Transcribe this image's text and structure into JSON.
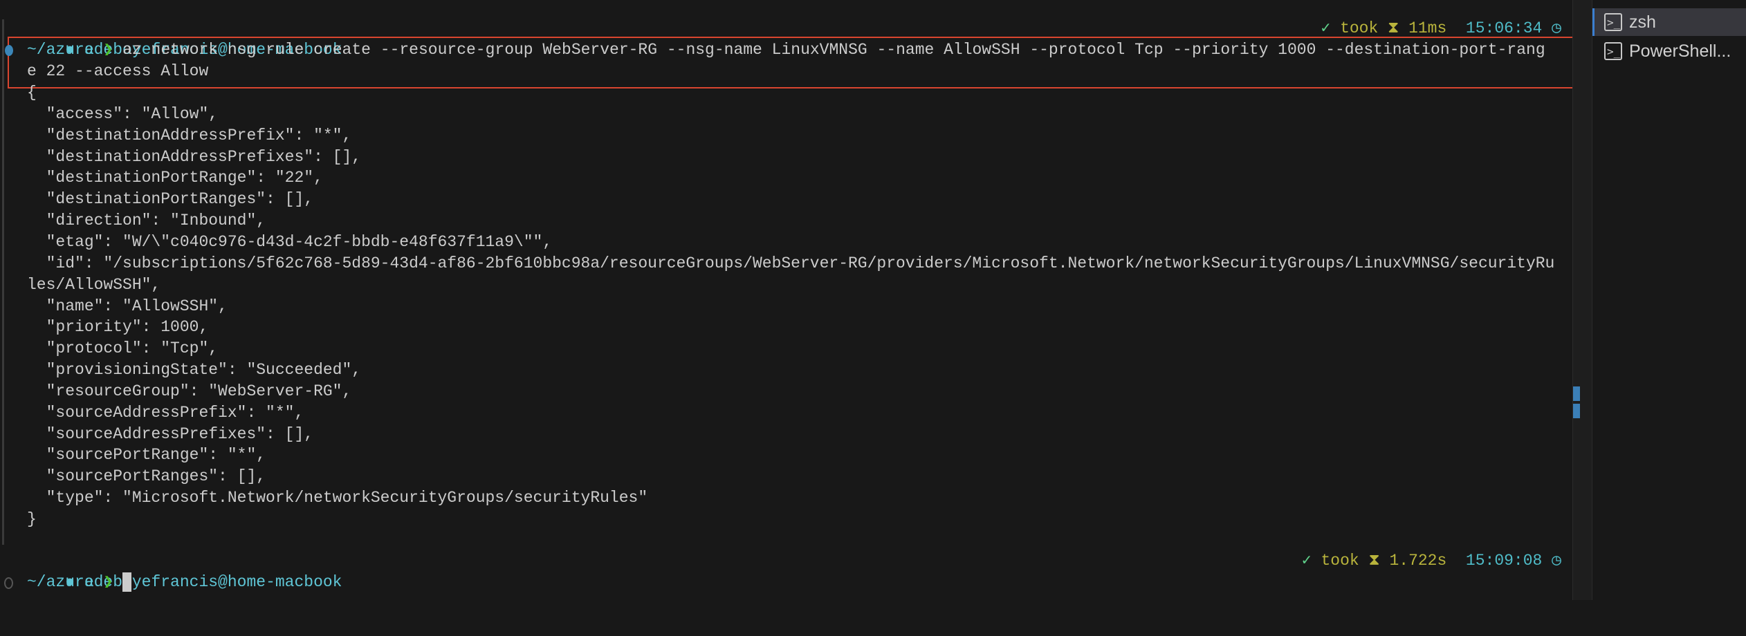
{
  "prompt1": {
    "apple_icon": "apple-icon",
    "user_host": "adeboyefrancis@home-macbook",
    "status_check": "✓",
    "took_label": "took",
    "hourglass": "⧗",
    "duration": "11ms",
    "time": "15:06:34"
  },
  "command": {
    "path": "~/azure",
    "arrow": "❯",
    "line1": "az network nsg rule create --resource-group WebServer-RG --nsg-name LinuxVMNSG --name AllowSSH --protocol Tcp --priority 1000 --destination-port-rang",
    "line2": "e 22 --access Allow"
  },
  "output": [
    "{",
    "  \"access\": \"Allow\",",
    "  \"destinationAddressPrefix\": \"*\",",
    "  \"destinationAddressPrefixes\": [],",
    "  \"destinationPortRange\": \"22\",",
    "  \"destinationPortRanges\": [],",
    "  \"direction\": \"Inbound\",",
    "  \"etag\": \"W/\\\"c040c976-d43d-4c2f-bbdb-e48f637f11a9\\\"\",",
    "  \"id\": \"/subscriptions/5f62c768-5d89-43d4-af86-2bf610bbc98a/resourceGroups/WebServer-RG/providers/Microsoft.Network/networkSecurityGroups/LinuxVMNSG/securityRu",
    "les/AllowSSH\",",
    "  \"name\": \"AllowSSH\",",
    "  \"priority\": 1000,",
    "  \"protocol\": \"Tcp\",",
    "  \"provisioningState\": \"Succeeded\",",
    "  \"resourceGroup\": \"WebServer-RG\",",
    "  \"sourceAddressPrefix\": \"*\",",
    "  \"sourceAddressPrefixes\": [],",
    "  \"sourcePortRange\": \"*\",",
    "  \"sourcePortRanges\": [],",
    "  \"type\": \"Microsoft.Network/networkSecurityGroups/securityRules\"",
    "}"
  ],
  "prompt2": {
    "user_host": "adeboyefrancis@home-macbook",
    "status_check": "✓",
    "took_label": "took",
    "hourglass": "⧗",
    "duration": "1.722s",
    "time": "15:09:08",
    "path": "~/azure",
    "arrow": "❯"
  },
  "sidebar": {
    "tabs": [
      {
        "label": "zsh",
        "active": true
      },
      {
        "label": "PowerShell..."
      }
    ]
  },
  "colors": {
    "background": "#181818",
    "cyan": "#5fc6d6",
    "prompt_arrow": "#4ec02c",
    "highlight_box": "#d9452f",
    "duration": "#b9b43c"
  }
}
